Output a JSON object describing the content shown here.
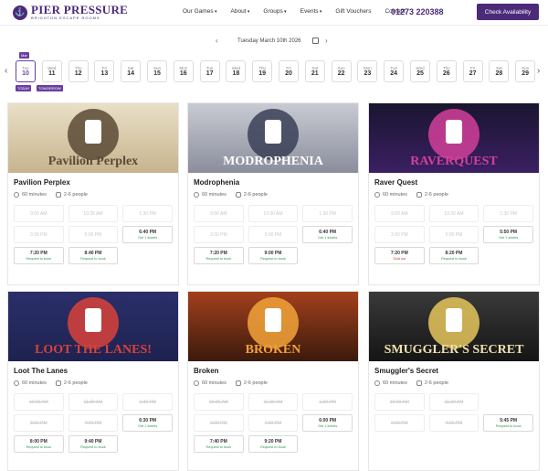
{
  "header": {
    "logo_title": "PIER PRESSURE",
    "logo_sub": "BRIGHTON ESCAPE ROOMS",
    "nav": [
      {
        "label": "Our Games",
        "chevron": true
      },
      {
        "label": "About",
        "chevron": true
      },
      {
        "label": "Groups",
        "chevron": true
      },
      {
        "label": "Events",
        "chevron": true
      },
      {
        "label": "Gift Vouchers",
        "chevron": false
      },
      {
        "label": "Contact",
        "chevron": false
      }
    ],
    "phone": "01273 220388",
    "cta": "Check Availability"
  },
  "date_nav": {
    "label": "Tuesday March 10th 2026"
  },
  "days": [
    {
      "name": "Tue",
      "num": "10",
      "selected": true
    },
    {
      "name": "Wed",
      "num": "11"
    },
    {
      "name": "Thu",
      "num": "12"
    },
    {
      "name": "Fri",
      "num": "13"
    },
    {
      "name": "Sat",
      "num": "14"
    },
    {
      "name": "Sun",
      "num": "15"
    },
    {
      "name": "Mon",
      "num": "16"
    },
    {
      "name": "Tue",
      "num": "17"
    },
    {
      "name": "Wed",
      "num": "18"
    },
    {
      "name": "Thu",
      "num": "19"
    },
    {
      "name": "Fri",
      "num": "20"
    },
    {
      "name": "Sat",
      "num": "21"
    },
    {
      "name": "Sun",
      "num": "22"
    },
    {
      "name": "Mon",
      "num": "23"
    },
    {
      "name": "Tue",
      "num": "24"
    },
    {
      "name": "Wed",
      "num": "25"
    },
    {
      "name": "Thu",
      "num": "26"
    },
    {
      "name": "Fri",
      "num": "27"
    },
    {
      "name": "Sat",
      "num": "28"
    },
    {
      "name": "Sun",
      "num": "29"
    }
  ],
  "day_flags": {
    "top": "Mar",
    "today": "TODAY",
    "tomorrow": "TOMORROW"
  },
  "cards": [
    {
      "title": "Pavilion Perplex",
      "art_title": "Pavilion Perplex",
      "duration": "60 minutes",
      "people": "2-6 people",
      "colors": {
        "bg1": "#e9dfc7",
        "bg2": "#c7b48e",
        "fg": "#5b4a35"
      },
      "slots": [
        {
          "time": "9:00 AM",
          "state": "booked"
        },
        {
          "time": "10:30 AM",
          "state": "booked"
        },
        {
          "time": "1:30 PM",
          "state": "booked"
        },
        {
          "time": "3:30 PM",
          "state": "booked"
        },
        {
          "time": "5:00 PM",
          "state": "booked"
        },
        {
          "time": "6:40 PM",
          "state": "avail",
          "status": "Get 1 tickets",
          "tone": "green"
        },
        {
          "time": "7:20 PM",
          "state": "avail",
          "status": "Request to book",
          "tone": "green"
        },
        {
          "time": "8:40 PM",
          "state": "avail",
          "status": "Request to book",
          "tone": "green"
        },
        {
          "time": "",
          "state": "empty"
        }
      ]
    },
    {
      "title": "Modrophenia",
      "art_title": "MODROPHENIA",
      "duration": "60 minutes",
      "people": "2-6 people",
      "colors": {
        "bg1": "#c9cbd3",
        "bg2": "#8a8e9c",
        "fg": "#3a3f57"
      },
      "slots": [
        {
          "time": "9:00 AM",
          "state": "booked"
        },
        {
          "time": "10:30 AM",
          "state": "booked"
        },
        {
          "time": "1:30 PM",
          "state": "booked"
        },
        {
          "time": "3:30 PM",
          "state": "booked"
        },
        {
          "time": "5:00 PM",
          "state": "booked"
        },
        {
          "time": "6:40 PM",
          "state": "avail",
          "status": "Get 1 tickets",
          "tone": "green"
        },
        {
          "time": "7:20 PM",
          "state": "avail",
          "status": "Request to book",
          "tone": "green"
        },
        {
          "time": "9:00 PM",
          "state": "avail",
          "status": "Request to book",
          "tone": "green"
        },
        {
          "time": "",
          "state": "empty"
        }
      ]
    },
    {
      "title": "Raver Quest",
      "art_title": "RAVERQUEST",
      "duration": "60 minutes",
      "people": "2-6 people",
      "colors": {
        "bg1": "#1a1530",
        "bg2": "#3b1f63",
        "fg": "#d2409a"
      },
      "slots": [
        {
          "time": "9:00 AM",
          "state": "booked"
        },
        {
          "time": "10:30 AM",
          "state": "booked"
        },
        {
          "time": "1:30 PM",
          "state": "booked"
        },
        {
          "time": "3:30 PM",
          "state": "booked"
        },
        {
          "time": "5:00 PM",
          "state": "booked"
        },
        {
          "time": "5:50 PM",
          "state": "avail",
          "status": "Get 1 tickets",
          "tone": "green"
        },
        {
          "time": "7:20 PM",
          "state": "avail",
          "status": "Sold out",
          "tone": "red"
        },
        {
          "time": "8:20 PM",
          "state": "avail",
          "status": "Request to book",
          "tone": "green"
        },
        {
          "time": "",
          "state": "empty"
        }
      ]
    },
    {
      "title": "Loot The Lanes",
      "art_title": "LOOT THE LANES!",
      "duration": "60 minutes",
      "people": "2-6 people",
      "colors": {
        "bg1": "#2a2f6a",
        "bg2": "#1e2250",
        "fg": "#d9423a"
      },
      "slots": [
        {
          "time": "10:00 AM",
          "state": "booked",
          "strike": true
        },
        {
          "time": "11:30 AM",
          "state": "booked",
          "strike": true
        },
        {
          "time": "1:30 PM",
          "state": "booked",
          "strike": true
        },
        {
          "time": "3:00 PM",
          "state": "booked",
          "strike": true
        },
        {
          "time": "4:40 PM",
          "state": "booked",
          "strike": true
        },
        {
          "time": "6:30 PM",
          "state": "avail",
          "status": "Get 1 tickets",
          "tone": "green"
        },
        {
          "time": "8:00 PM",
          "state": "avail",
          "status": "Request to book",
          "tone": "green"
        },
        {
          "time": "9:40 PM",
          "state": "avail",
          "status": "Request to book",
          "tone": "green"
        },
        {
          "time": "",
          "state": "empty"
        }
      ]
    },
    {
      "title": "Broken",
      "art_title": "BROKEN",
      "duration": "60 minutes",
      "people": "2-6 people",
      "colors": {
        "bg1": "#a3401c",
        "bg2": "#3b1a0c",
        "fg": "#f2a33a"
      },
      "slots": [
        {
          "time": "10:00 AM",
          "state": "booked",
          "strike": true
        },
        {
          "time": "11:30 AM",
          "state": "booked",
          "strike": true
        },
        {
          "time": "1:30 PM",
          "state": "booked",
          "strike": true
        },
        {
          "time": "2:30 PM",
          "state": "booked",
          "strike": true
        },
        {
          "time": "4:30 PM",
          "state": "booked",
          "strike": true
        },
        {
          "time": "6:00 PM",
          "state": "avail",
          "status": "Get 1 tickets",
          "tone": "green"
        },
        {
          "time": "7:40 PM",
          "state": "avail",
          "status": "Request to book",
          "tone": "green"
        },
        {
          "time": "9:20 PM",
          "state": "avail",
          "status": "Request to book",
          "tone": "green"
        },
        {
          "time": "",
          "state": "empty"
        }
      ]
    },
    {
      "title": "Smuggler's Secret",
      "art_title": "SMUGGLER'S SECRET",
      "duration": "60 minutes",
      "people": "2-6 people",
      "colors": {
        "bg1": "#3a3a3a",
        "bg2": "#151515",
        "fg": "#e6c65a"
      },
      "slots": [
        {
          "time": "10:00 AM",
          "state": "booked",
          "strike": true
        },
        {
          "time": "11:30 AM",
          "state": "booked",
          "strike": true
        },
        {
          "time": "",
          "state": "empty"
        },
        {
          "time": "2:30 PM",
          "state": "booked",
          "strike": true
        },
        {
          "time": "4:00 PM",
          "state": "booked",
          "strike": true
        },
        {
          "time": "5:45 PM",
          "state": "avail",
          "status": "Request to book",
          "tone": "green"
        },
        {
          "time": "",
          "state": "empty"
        },
        {
          "time": "",
          "state": "empty"
        },
        {
          "time": "",
          "state": "empty"
        }
      ]
    }
  ]
}
